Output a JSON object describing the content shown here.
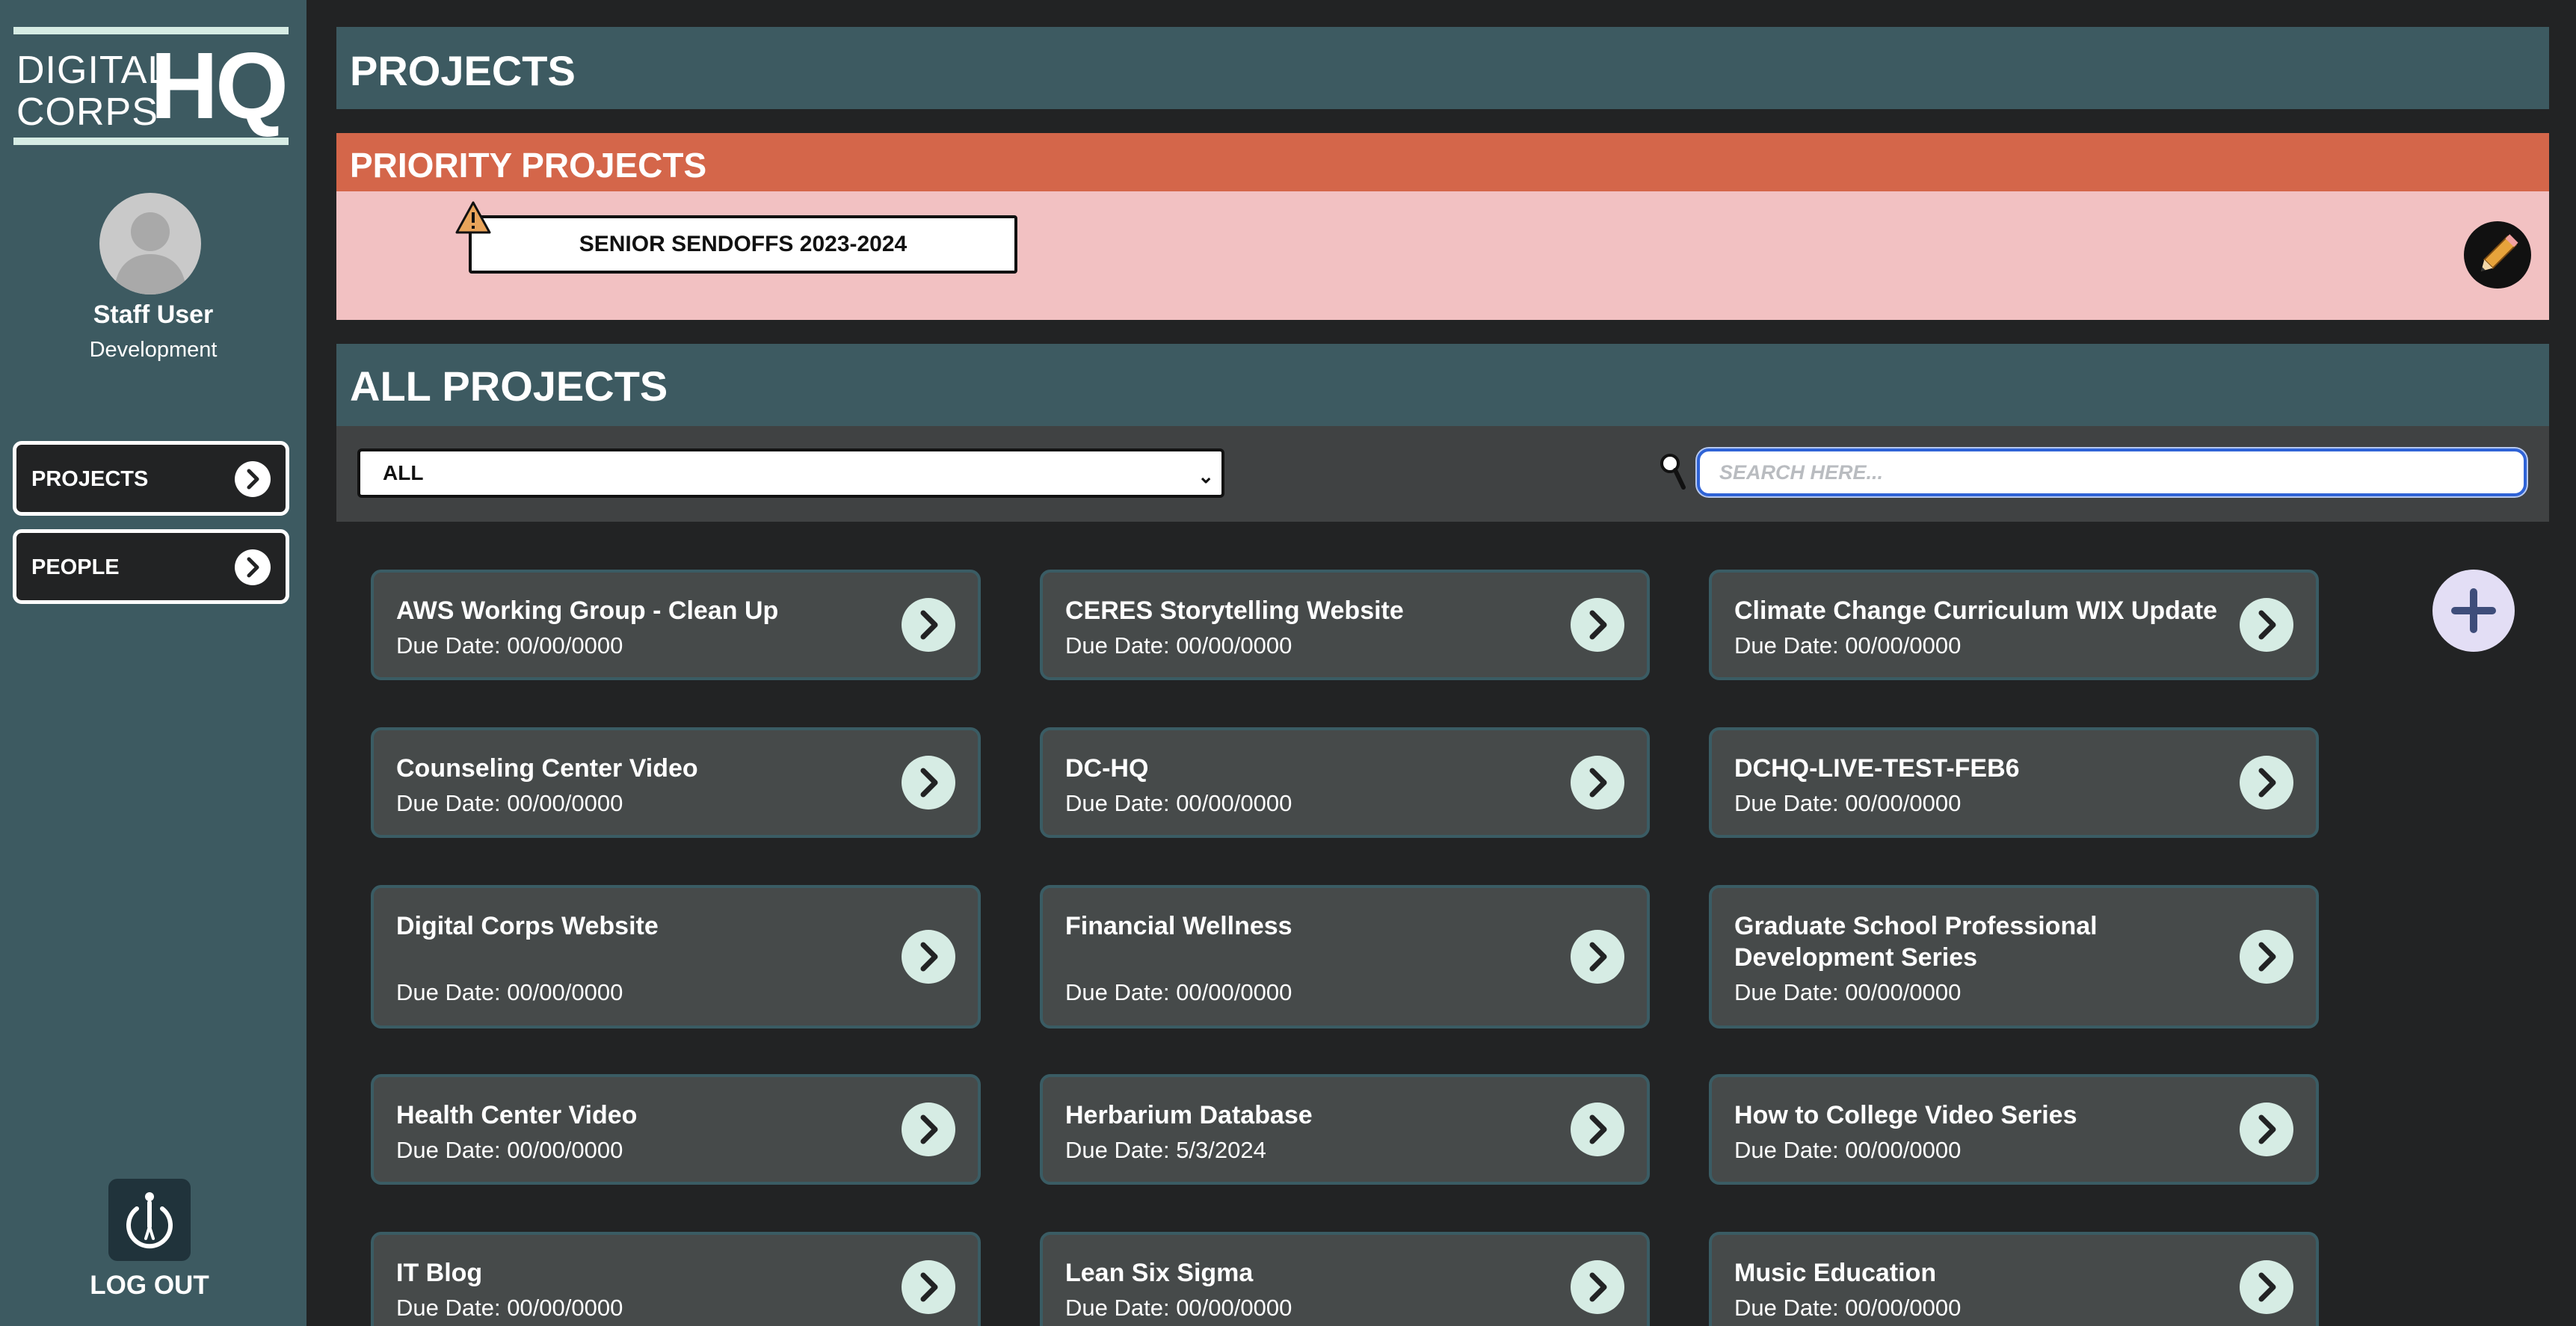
{
  "colors": {
    "sidebar_bg": "#3d5a61",
    "main_bg": "#222324",
    "header_bg": "#3d5a61",
    "priority_header": "#d4664a",
    "priority_body": "#f2c1c2",
    "card_bg": "#464a4a",
    "accent_mint": "#d6ece4",
    "add_button": "#e3def5"
  },
  "logo": {
    "line1": "DIGITAL",
    "line2": "CORPS",
    "hq": "HQ"
  },
  "user": {
    "name": "Staff User",
    "department": "Development"
  },
  "nav": [
    {
      "label": "PROJECTS",
      "icon": "chevron-right-circle-icon"
    },
    {
      "label": "PEOPLE",
      "icon": "chevron-right-circle-icon"
    }
  ],
  "logout": {
    "label": "LOG OUT",
    "icon": "power-icon"
  },
  "page": {
    "title": "PROJECTS",
    "priority": {
      "title": "PRIORITY PROJECTS",
      "item": "SENIOR SENDOFFS 2023-2024",
      "edit_icon": "pencil-icon",
      "warning_icon": "warning-icon"
    },
    "all": {
      "title": "ALL PROJECTS",
      "filter_value": "ALL",
      "search_placeholder": "SEARCH HERE..."
    }
  },
  "projects": [
    {
      "title": "AWS Working Group - Clean Up",
      "due": "Due Date: 00/00/0000"
    },
    {
      "title": "CERES Storytelling Website",
      "due": "Due Date: 00/00/0000"
    },
    {
      "title": "Climate Change Curriculum WIX Update",
      "due": "Due Date: 00/00/0000"
    },
    {
      "title": "Counseling Center Video",
      "due": "Due Date: 00/00/0000"
    },
    {
      "title": "DC-HQ",
      "due": "Due Date: 00/00/0000"
    },
    {
      "title": "DCHQ-LIVE-TEST-FEB6",
      "due": "Due Date: 00/00/0000"
    },
    {
      "title": "Digital Corps Website",
      "due": "Due Date: 00/00/0000"
    },
    {
      "title": "Financial Wellness",
      "due": "Due Date: 00/00/0000"
    },
    {
      "title": "Graduate School Professional Development Series",
      "due": "Due Date: 00/00/0000"
    },
    {
      "title": "Health Center Video",
      "due": "Due Date: 00/00/0000"
    },
    {
      "title": "Herbarium Database",
      "due": "Due Date: 5/3/2024"
    },
    {
      "title": "How to College Video Series",
      "due": "Due Date: 00/00/0000"
    },
    {
      "title": "IT Blog",
      "due": "Due Date: 00/00/0000"
    },
    {
      "title": "Lean Six Sigma",
      "due": "Due Date: 00/00/0000"
    },
    {
      "title": "Music Education",
      "due": "Due Date: 00/00/0000"
    }
  ]
}
